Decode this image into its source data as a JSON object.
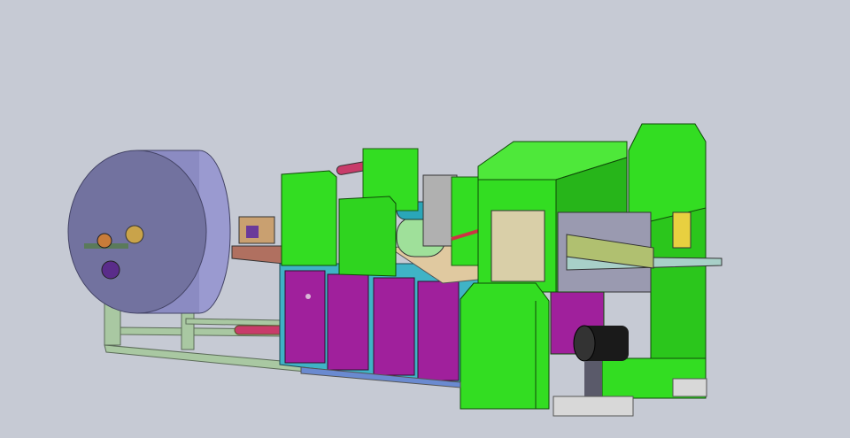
{
  "scene": {
    "subject": "napkin-folding-machine-cad-model",
    "colors": {
      "background": "#c6cad4",
      "paper_roll": "#8b8bc2",
      "paper_roll_face": "#72729f",
      "guard_green": "#33dd22",
      "guard_green_dark": "#1f9a12",
      "cabinet_purple": "#a0209c",
      "frame_cyan": "#3fb3c6",
      "frame_stand": "#a9c8a2",
      "motor": "#1a1a1a",
      "base_gray": "#d8d8d8",
      "roller_red": "#c83c6a",
      "roller_teal": "#2aa6b8"
    }
  }
}
